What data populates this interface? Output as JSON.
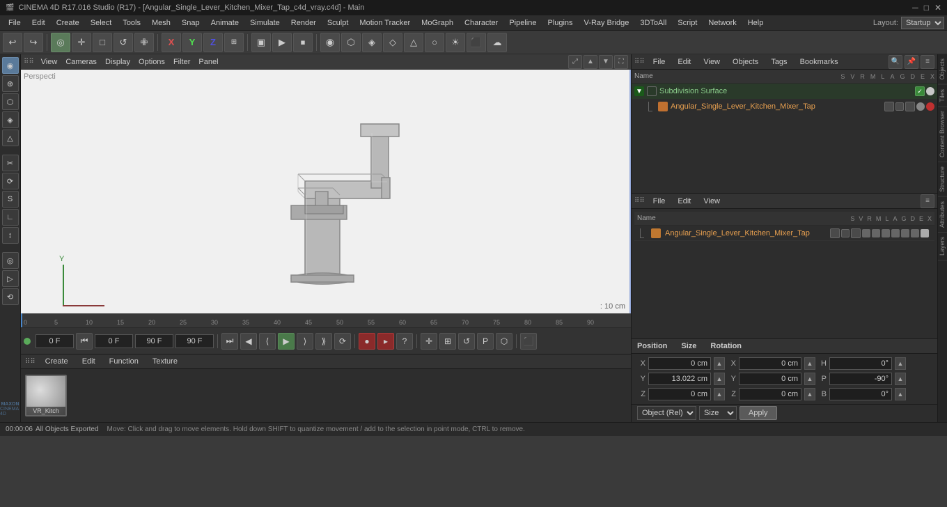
{
  "titlebar": {
    "title": "CINEMA 4D R17.016 Studio (R17) - [Angular_Single_Lever_Kitchen_Mixer_Tap_c4d_vray.c4d] - Main",
    "app_icon": "C4D",
    "controls": [
      "─",
      "□",
      "✕"
    ]
  },
  "menubar": {
    "items": [
      "File",
      "Edit",
      "Create",
      "Select",
      "Tools",
      "Mesh",
      "Snap",
      "Animate",
      "Simulate",
      "Render",
      "Sculpt",
      "Motion Tracker",
      "MoGraph",
      "Character",
      "Pipeline",
      "Plugins",
      "V-Ray Bridge",
      "3DToAll",
      "Script",
      "Network",
      "Help"
    ],
    "layout_label": "Layout:",
    "layout_value": "Startup"
  },
  "toolbar": {
    "undo": "↩",
    "redo": "↪",
    "tools": [
      "◎",
      "✛",
      "□",
      "↺",
      "✙",
      "X",
      "Y",
      "Z",
      "⊞",
      "▶",
      "⏸",
      "⏹",
      "◉",
      "◈",
      "⬡",
      "◇",
      "△",
      "○",
      "⬛",
      "☀"
    ]
  },
  "viewport": {
    "perspective_label": "Perspecti",
    "scale_label": ": 10 cm",
    "view_menu": [
      "View",
      "Cameras",
      "Display",
      "Options",
      "Filter",
      "Panel"
    ]
  },
  "objects": {
    "panel_title": "Objects",
    "menus": [
      "File",
      "Edit",
      "View"
    ],
    "items": [
      {
        "name": "Subdivision Surface",
        "type": "null",
        "color": "green"
      },
      {
        "name": "Angular_Single_Lever_Kitchen_Mixer_Tap",
        "type": "obj",
        "color": "orange",
        "indent": 1
      }
    ],
    "columns": [
      "Name",
      "S",
      "V",
      "R",
      "M",
      "L",
      "A",
      "G",
      "D",
      "E",
      "X"
    ]
  },
  "attributes": {
    "panel_title": "Attributes",
    "menus": [
      "File",
      "Edit",
      "View"
    ],
    "items": [
      {
        "name": "Angular_Single_Lever_Kitchen_Mixer_Tap",
        "type": "obj",
        "color": "orange"
      }
    ],
    "columns": [
      "Name",
      "S",
      "V",
      "R",
      "M",
      "L",
      "A",
      "G",
      "D",
      "E",
      "X"
    ]
  },
  "coordinates": {
    "position_label": "Position",
    "size_label": "Size",
    "rotation_label": "Rotation",
    "rows": [
      {
        "axis": "X",
        "pos": "0 cm",
        "size": "0 cm",
        "rot_label": "H",
        "rot": "0°"
      },
      {
        "axis": "Y",
        "pos": "13.022 cm",
        "size": "0 cm",
        "rot_label": "P",
        "rot": "-90°"
      },
      {
        "axis": "Z",
        "pos": "0 cm",
        "size": "0 cm",
        "rot_label": "B",
        "rot": "0°"
      }
    ],
    "object_dropdown": "Object (Rel)",
    "coord_dropdown": "Size",
    "apply_label": "Apply"
  },
  "timeline": {
    "start_frame": "0 F",
    "current_frame": "0 F",
    "end_frame": "90 F",
    "fps_frame": "90 F",
    "markers": [
      0,
      5,
      10,
      15,
      20,
      25,
      30,
      35,
      40,
      45,
      50,
      55,
      60,
      65,
      70,
      75,
      80,
      85,
      90
    ],
    "current_f_label": "0 F"
  },
  "materials": {
    "menus": [
      "Create",
      "Edit",
      "Function",
      "Texture"
    ],
    "items": [
      {
        "name": "VR_Kitch",
        "label": "VR_Kitch"
      }
    ]
  },
  "statusbar": {
    "time": "00:00:06",
    "status": "All Objects Exported",
    "hint": "Move: Click and drag to move elements. Hold down SHIFT to quantize movement / add to the selection in point mode, CTRL to remove."
  },
  "right_tabs": [
    "Objects",
    "Tiles",
    "Content Browser",
    "Structure",
    "Attributes",
    "Layers"
  ],
  "far_right_tabs": [
    "Objects",
    "Tiles",
    "Content Browser",
    "Structure",
    "Attributes",
    "Layers"
  ]
}
